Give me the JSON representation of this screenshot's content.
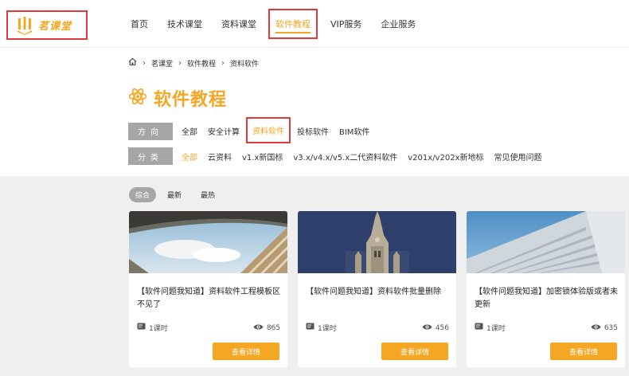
{
  "brand": {
    "name": "茗课堂",
    "accent": "#f5a623",
    "highlight": "#e03a3a"
  },
  "nav": {
    "items": [
      {
        "label": "首页"
      },
      {
        "label": "技术课堂"
      },
      {
        "label": "资料课堂"
      },
      {
        "label": "软件教程",
        "active": true
      },
      {
        "label": "VIP服务"
      },
      {
        "label": "企业服务"
      }
    ]
  },
  "breadcrumb": {
    "home_icon": "home-icon",
    "items": [
      "茗课堂",
      "软件教程",
      "资料软件"
    ]
  },
  "page_title": "软件教程",
  "filters": {
    "direction": {
      "label": "方向",
      "options": [
        "全部",
        "安全计算",
        "资料软件",
        "投标软件",
        "BIM软件"
      ],
      "selected": "资料软件"
    },
    "category": {
      "label": "分类",
      "options": [
        "全部",
        "云资料",
        "v1.x新国标",
        "v3.x/v4.x/v5.x二代资料软件",
        "v201x/v202x新地标",
        "常见使用问题"
      ],
      "selected": "全部"
    }
  },
  "sort": {
    "tabs": [
      "综合",
      "最新",
      "最热"
    ],
    "selected": "综合"
  },
  "cards": [
    {
      "title": "【软件问题我知道】资料软件工程模板区不见了",
      "lessons": "1课时",
      "views": "865",
      "button": "查看详情"
    },
    {
      "title": "【软件问题我知道】资料软件批量删除",
      "lessons": "1课时",
      "views": "456",
      "button": "查看详情"
    },
    {
      "title": "【软件问题我知道】加密锁体验版或者未更新",
      "lessons": "1课时",
      "views": "635",
      "button": "查看详情"
    }
  ]
}
